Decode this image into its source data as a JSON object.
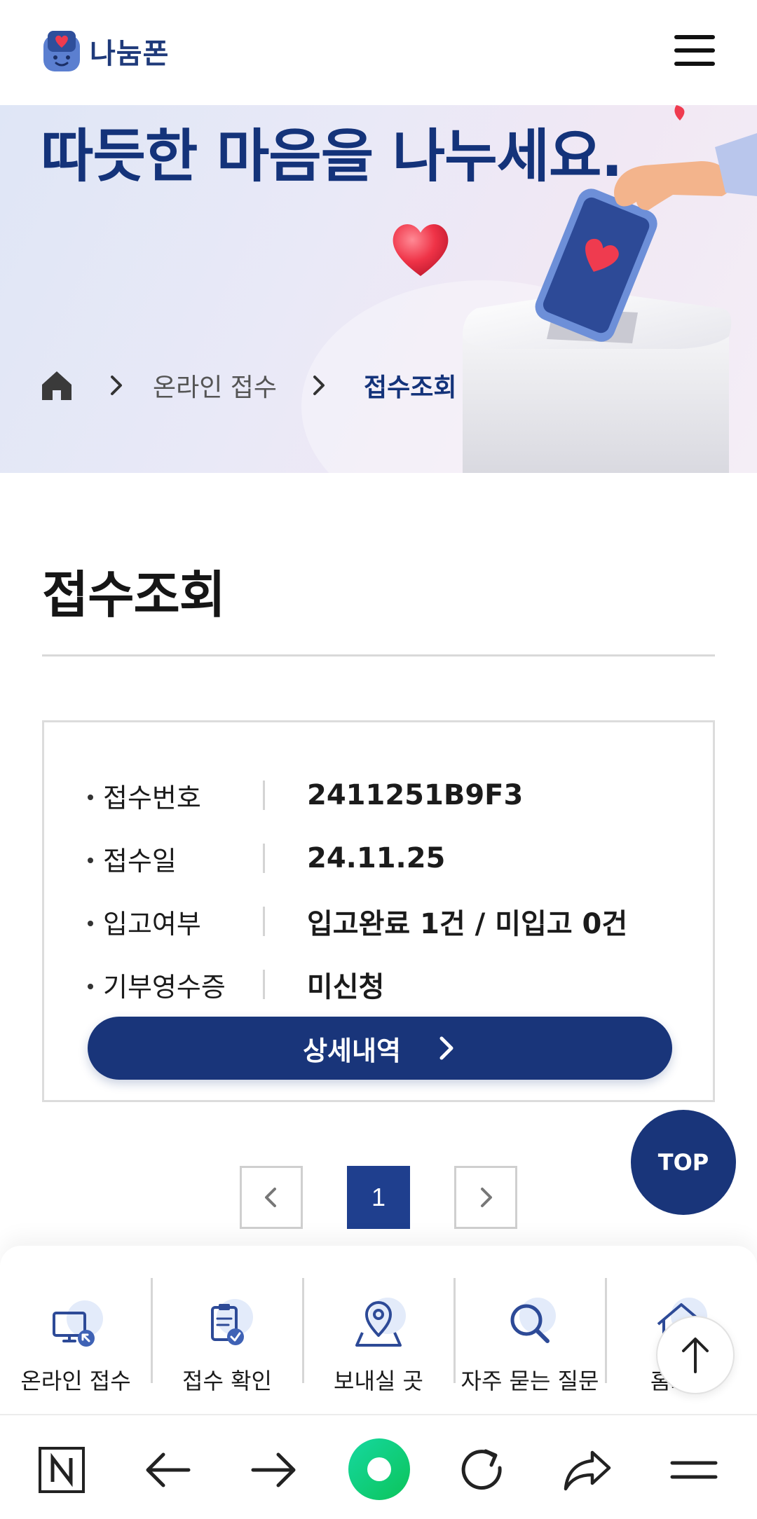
{
  "header": {
    "logo_text": "나눔폰",
    "menu_icon": "hamburger-menu-icon"
  },
  "hero": {
    "title": "따듯한 마음을 나누세요.",
    "breadcrumb": {
      "home_icon": "home-icon",
      "items": [
        "온라인 접수",
        "접수조회"
      ]
    }
  },
  "page": {
    "title": "접수조회"
  },
  "card": {
    "rows": [
      {
        "label": "접수번호",
        "value": "2411251B9F3"
      },
      {
        "label": "접수일",
        "value": "24.11.25"
      },
      {
        "label": "입고여부",
        "value": "입고완료 1건 / 미입고 0건"
      },
      {
        "label": "기부영수증",
        "value": "미신청"
      }
    ],
    "detail_button": "상세내역"
  },
  "top_button": "TOP",
  "pagination": {
    "current": "1"
  },
  "quick_nav": {
    "items": [
      {
        "label": "온라인 접수",
        "icon": "computer-icon"
      },
      {
        "label": "접수 확인",
        "icon": "clipboard-check-icon"
      },
      {
        "label": "보내실 곳",
        "icon": "map-pin-icon"
      },
      {
        "label": "자주 묻는 질문",
        "icon": "search-icon"
      },
      {
        "label": "홈으로",
        "icon": "house-icon"
      }
    ]
  },
  "browser_bar": {
    "icons": [
      "naver-n-icon",
      "back-arrow-icon",
      "forward-arrow-icon",
      "green-home-dot-icon",
      "reload-icon",
      "share-icon",
      "menu-icon"
    ]
  },
  "colors": {
    "brand_navy": "#19357a",
    "page_current": "#1f3f8e",
    "accent_green": "#14d07a"
  }
}
